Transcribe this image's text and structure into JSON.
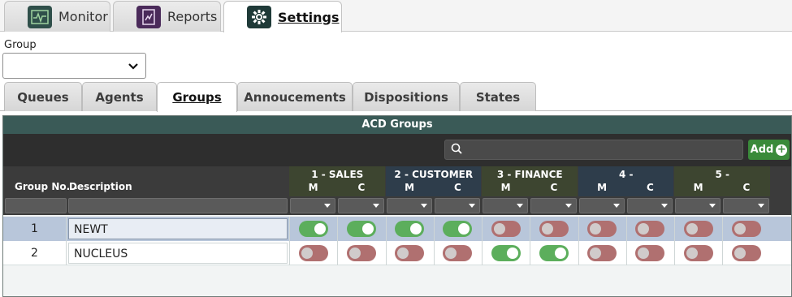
{
  "top_tabs": [
    {
      "label": "Monitor",
      "icon": "monitor-icon"
    },
    {
      "label": "Reports",
      "icon": "reports-icon"
    },
    {
      "label": "Settings",
      "icon": "settings-gear-icon",
      "active": true
    }
  ],
  "group": {
    "label": "Group",
    "value": ""
  },
  "sub_tabs": [
    {
      "label": "Queues"
    },
    {
      "label": "Agents"
    },
    {
      "label": "Groups",
      "active": true
    },
    {
      "label": "Annoucements"
    },
    {
      "label": "Dispositions"
    },
    {
      "label": "States"
    }
  ],
  "panel": {
    "title": "ACD Groups",
    "search_placeholder": "",
    "add_label": "Add"
  },
  "columns": {
    "group_no": "Group No.",
    "sort_arrow": "▲",
    "description": "Description",
    "queues": [
      {
        "name": "1 - SALES",
        "m": "M",
        "c": "C"
      },
      {
        "name": "2 - CUSTOMER",
        "m": "M",
        "c": "C"
      },
      {
        "name": "3 - FINANCE",
        "m": "M",
        "c": "C"
      },
      {
        "name": "4 -",
        "m": "M",
        "c": "C"
      },
      {
        "name": "5 -",
        "m": "M",
        "c": "C"
      }
    ]
  },
  "rows": [
    {
      "no": "1",
      "description": "NEWT",
      "toggles": [
        true,
        true,
        true,
        true,
        false,
        false,
        false,
        false,
        false,
        false
      ]
    },
    {
      "no": "2",
      "description": "NUCLEUS",
      "toggles": [
        false,
        false,
        false,
        false,
        true,
        true,
        false,
        false,
        false,
        false
      ]
    }
  ],
  "colors": {
    "panel_title_bg": "#3a5a57",
    "toggle_on": "#5cae5c",
    "toggle_off": "#b07070",
    "add_button": "#3a8a3a",
    "selected_row": "#b8c6da"
  }
}
